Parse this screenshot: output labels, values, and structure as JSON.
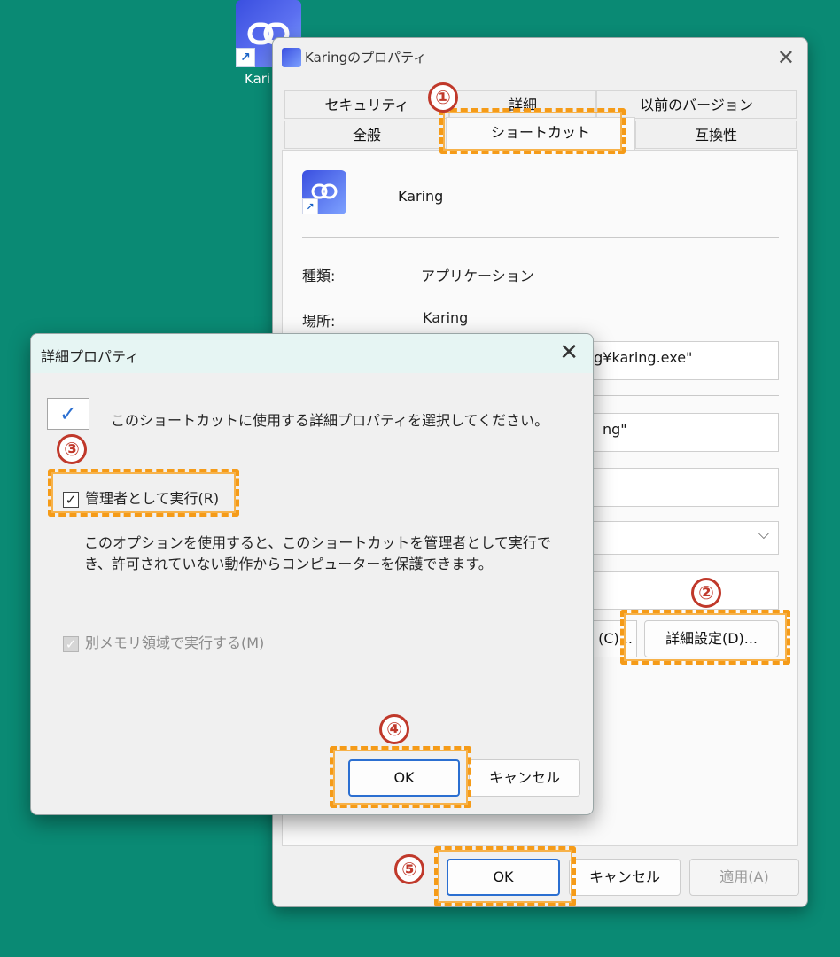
{
  "desktop": {
    "icon_label": "Kari"
  },
  "properties_window": {
    "title": "Karingのプロパティ",
    "tabs_row_back": [
      "セキュリティ",
      "詳細",
      "以前のバージョン"
    ],
    "tabs_row_front": [
      "全般",
      "ショートカット",
      "互換性"
    ],
    "app_name": "Karing",
    "type_label": "種類:",
    "type_value": "アプリケーション",
    "location_label": "場所:",
    "location_value": "Karing",
    "target_value": "ng¥karing.exe\"",
    "start_in_value": "ng\"",
    "change_icon_fragment": "(C)...",
    "advanced_button": "詳細設定(D)...",
    "ok": "OK",
    "cancel": "キャンセル",
    "apply": "適用(A)"
  },
  "advanced_dialog": {
    "title": "詳細プロパティ",
    "instruction": "このショートカットに使用する詳細プロパティを選択してください。",
    "run_as_admin": "管理者として実行(R)",
    "run_as_admin_checked": true,
    "description_line1": "このオプションを使用すると、このショートカットを管理者として実行で",
    "description_line2": "き、許可されていない動作からコンピューターを保護できます。",
    "separate_memory": "別メモリ領域で実行する(M)",
    "separate_memory_checked": true,
    "ok": "OK",
    "cancel": "キャンセル"
  },
  "annotations": {
    "step1": "①",
    "step2": "②",
    "step3": "③",
    "step4": "④",
    "step5": "⑤"
  },
  "colors": {
    "desktop": "#0a8a74",
    "highlight": "#f59b18",
    "step_number": "#c0392b",
    "accent": "#2b6fd1"
  }
}
